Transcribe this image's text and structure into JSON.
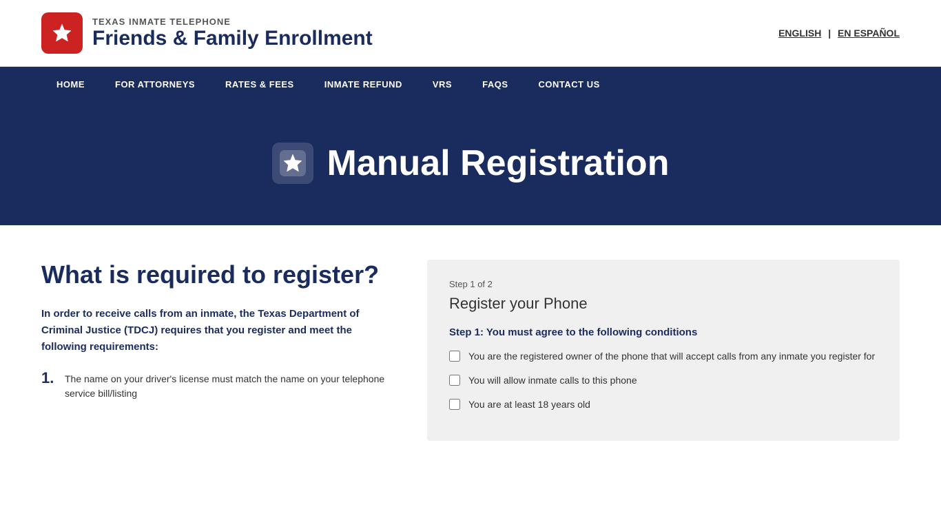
{
  "header": {
    "logo_subtitle": "TEXAS INMATE TELEPHONE",
    "logo_title": "Friends & Family Enrollment",
    "lang_english": "ENGLISH",
    "lang_separator": "|",
    "lang_spanish": "EN ESPAÑOL"
  },
  "nav": {
    "items": [
      {
        "label": "HOME",
        "id": "home"
      },
      {
        "label": "FOR ATTORNEYS",
        "id": "for-attorneys"
      },
      {
        "label": "RATES & FEES",
        "id": "rates-fees"
      },
      {
        "label": "INMATE REFUND",
        "id": "inmate-refund"
      },
      {
        "label": "VRS",
        "id": "vrs"
      },
      {
        "label": "FAQS",
        "id": "faqs"
      },
      {
        "label": "CONTACT US",
        "id": "contact-us"
      }
    ]
  },
  "hero": {
    "title": "Manual Registration"
  },
  "left": {
    "heading": "What is required to register?",
    "intro": "In order to receive calls from an inmate, the Texas Department of Criminal Justice (TDCJ) requires that you register and meet the following requirements:",
    "requirements": [
      {
        "number": "1.",
        "text": "The name on your driver's license must match the name on your telephone service bill/listing"
      }
    ]
  },
  "form": {
    "step_indicator": "Step 1 of 2",
    "section_title": "Register your Phone",
    "step_label": "Step 1: You must agree to the following conditions",
    "conditions": [
      {
        "id": "cond1",
        "text": "You are the registered owner of the phone that will accept calls from any inmate you register for"
      },
      {
        "id": "cond2",
        "text": "You will allow inmate calls to this phone"
      },
      {
        "id": "cond3",
        "text": "You are at least 18 years old"
      }
    ]
  }
}
